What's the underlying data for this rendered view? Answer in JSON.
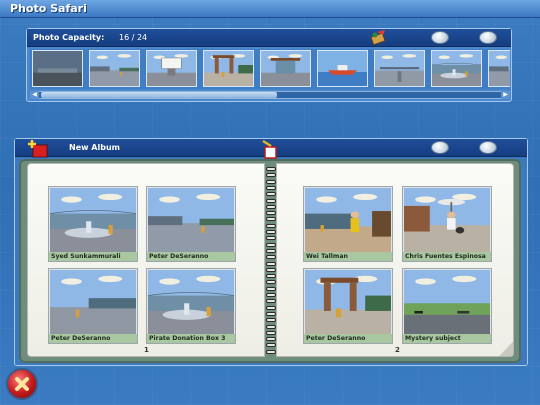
{
  "window": {
    "title": "Photo Safari"
  },
  "capacity": {
    "label": "Photo Capacity:",
    "count": "16 / 24"
  },
  "album": {
    "title": "New Album",
    "pages": [
      {
        "number": "1",
        "photos": [
          {
            "caption": "Syed Sunkammurali",
            "scene": "fountain"
          },
          {
            "caption": "Peter DeSeranno",
            "scene": "plaza"
          },
          {
            "caption": "Peter DeSeranno",
            "scene": "plaza-far"
          },
          {
            "caption": "Pirate Donation Box 3",
            "scene": "fountain"
          }
        ]
      },
      {
        "number": "2",
        "photos": [
          {
            "caption": "Wei Tallman",
            "scene": "person"
          },
          {
            "caption": "Chris Fuentes Espinosa",
            "scene": "hut-person"
          },
          {
            "caption": "Peter DeSeranno",
            "scene": "hut"
          },
          {
            "caption": "Mystery subject",
            "scene": "field"
          }
        ]
      }
    ]
  },
  "strip": [
    {
      "scene": "dark-sky"
    },
    {
      "scene": "plaza"
    },
    {
      "scene": "sign"
    },
    {
      "scene": "hut"
    },
    {
      "scene": "kiosk"
    },
    {
      "scene": "ship"
    },
    {
      "scene": "bridge"
    },
    {
      "scene": "fountain"
    },
    {
      "scene": "plaza"
    }
  ],
  "icons": {
    "toucan": "toucan-icon",
    "add": "add-photo-icon",
    "trash": "trash-icon",
    "close": "close-icon"
  },
  "colors": {
    "accent": "#3b7cc0",
    "header": "#163e80",
    "caption": "#a9c8a2",
    "close": "#c0191c"
  }
}
